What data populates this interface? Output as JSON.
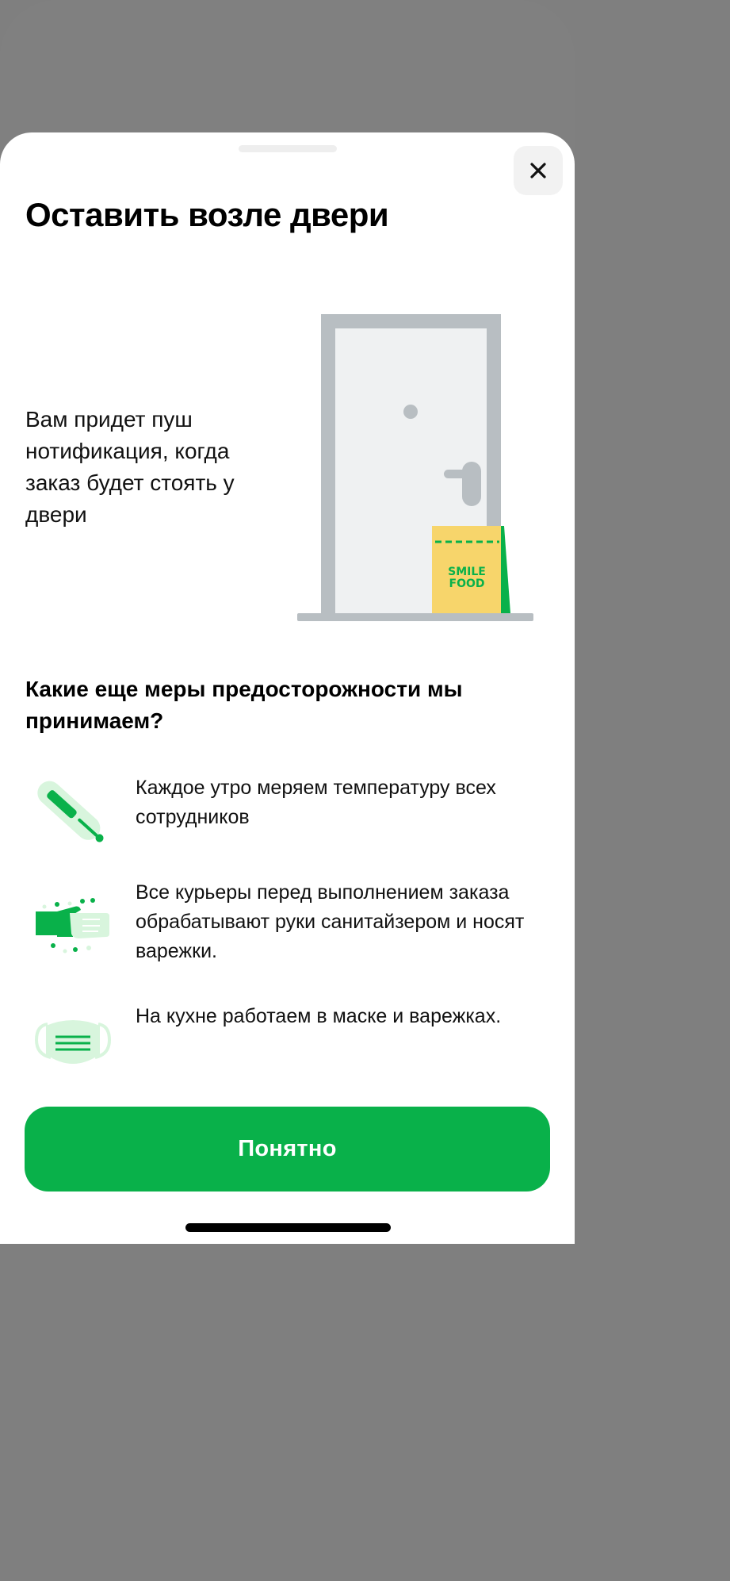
{
  "sheet": {
    "title": "Оставить возле двери",
    "close_icon": "close-icon"
  },
  "intro": {
    "text": "Вам придет пуш нотификация, когда заказ будет стоять у двери"
  },
  "illustration": {
    "icon": "door-with-bag-illustration",
    "bag_logo_line1": "SMILE",
    "bag_logo_line2": "FOOD"
  },
  "precautions": {
    "title": "Какие еще меры предосторожности мы принимаем?",
    "items": [
      {
        "icon": "thermometer-icon",
        "text": "Каждое утро меряем температуру всех сотрудников"
      },
      {
        "icon": "hand-sanitizer-icon",
        "text": "Все курьеры перед выполнением заказа обрабатывают руки санитайзером и носят варежки."
      },
      {
        "icon": "face-mask-icon",
        "text": "На кухне работаем в маске и варежках."
      }
    ]
  },
  "actions": {
    "ok_label": "Понятно"
  },
  "colors": {
    "brand_green": "#09b14a",
    "light_green": "#d8f5dd",
    "bag_yellow": "#f7d56b",
    "door_grey": "#b8bec2",
    "overlay": "#808080"
  }
}
